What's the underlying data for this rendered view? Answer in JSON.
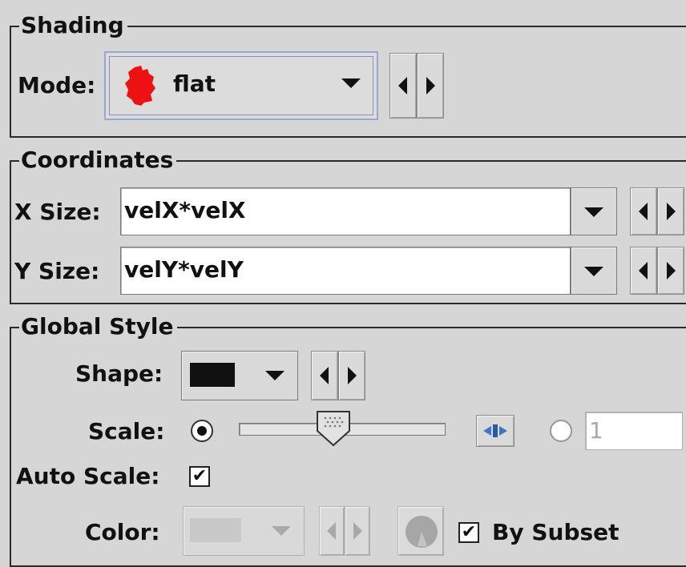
{
  "shading": {
    "title": "Shading",
    "mode_label": "Mode:",
    "mode_value": "flat",
    "mode_icon": "red-blob-icon"
  },
  "coordinates": {
    "title": "Coordinates",
    "xsize_label": "X Size:",
    "xsize_value": "velX*velX",
    "ysize_label": "Y Size:",
    "ysize_value": "velY*velY"
  },
  "global_style": {
    "title": "Global Style",
    "shape_label": "Shape:",
    "shape_value_color": "#111111",
    "scale_label": "Scale:",
    "scale_slider_value": 0.45,
    "scale_text_value": "1",
    "auto_scale_label": "Auto Scale:",
    "auto_scale_checked": true,
    "color_label": "Color:",
    "by_subset_label": "By Subset",
    "by_subset_checked": true
  },
  "colors": {
    "background": "#d6d6d6",
    "mode_combo_highlight": "#9aa6d8",
    "flat_icon_red": "#ee1111",
    "disabled": "#a9a9a9"
  }
}
